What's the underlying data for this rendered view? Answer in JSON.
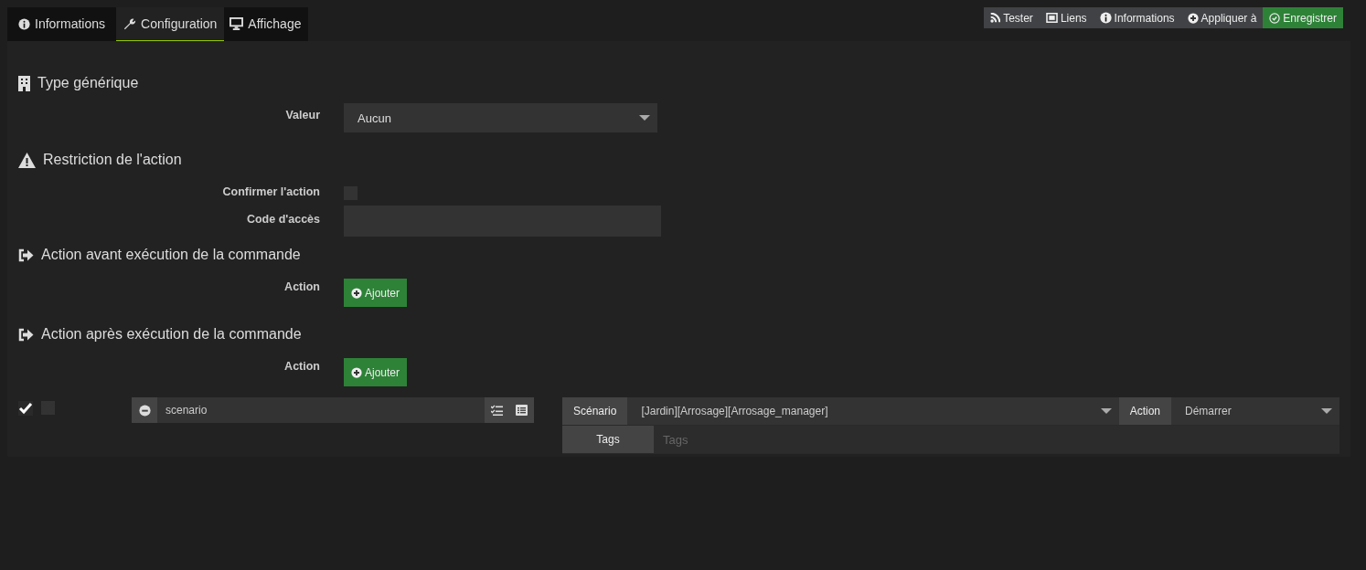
{
  "tabs": [
    {
      "label": "Informations",
      "selected": false
    },
    {
      "label": "Configuration",
      "selected": true
    },
    {
      "label": "Affichage",
      "selected": false
    }
  ],
  "toolbar": [
    {
      "label": "Tester",
      "kind": "plain"
    },
    {
      "label": "Liens",
      "kind": "plain"
    },
    {
      "label": "Informations",
      "kind": "plain"
    },
    {
      "label": "Appliquer à",
      "kind": "plain"
    },
    {
      "label": "Enregistrer",
      "kind": "primary"
    }
  ],
  "sections": [
    {
      "title": "Type générique",
      "fields": [
        {
          "kind": "select",
          "label": "Valeur",
          "value": "Aucun"
        }
      ]
    },
    {
      "title": "Restriction de l'action",
      "fields": [
        {
          "kind": "checkbox",
          "label": "Confirmer l'action",
          "checked": false
        },
        {
          "kind": "text",
          "label": "Code d'accès"
        }
      ]
    },
    {
      "title": "Action avant exécution de la commande",
      "fields": [
        {
          "kind": "button",
          "label": "Action",
          "button": "Ajouter"
        }
      ]
    },
    {
      "title": "Action après exécution de la commande",
      "fields": [
        {
          "kind": "button",
          "label": "Action",
          "button": "Ajouter"
        }
      ]
    }
  ],
  "action_row": {
    "enabled": true,
    "background": false,
    "command": "scenario",
    "scenario_label": "Scénario",
    "scenario_value": "[Jardin][Arrosage][Arrosage_manager]",
    "action_label": "Action",
    "action_value": "Démarrer",
    "tags_label": "Tags",
    "tags_placeholder": "Tags"
  }
}
